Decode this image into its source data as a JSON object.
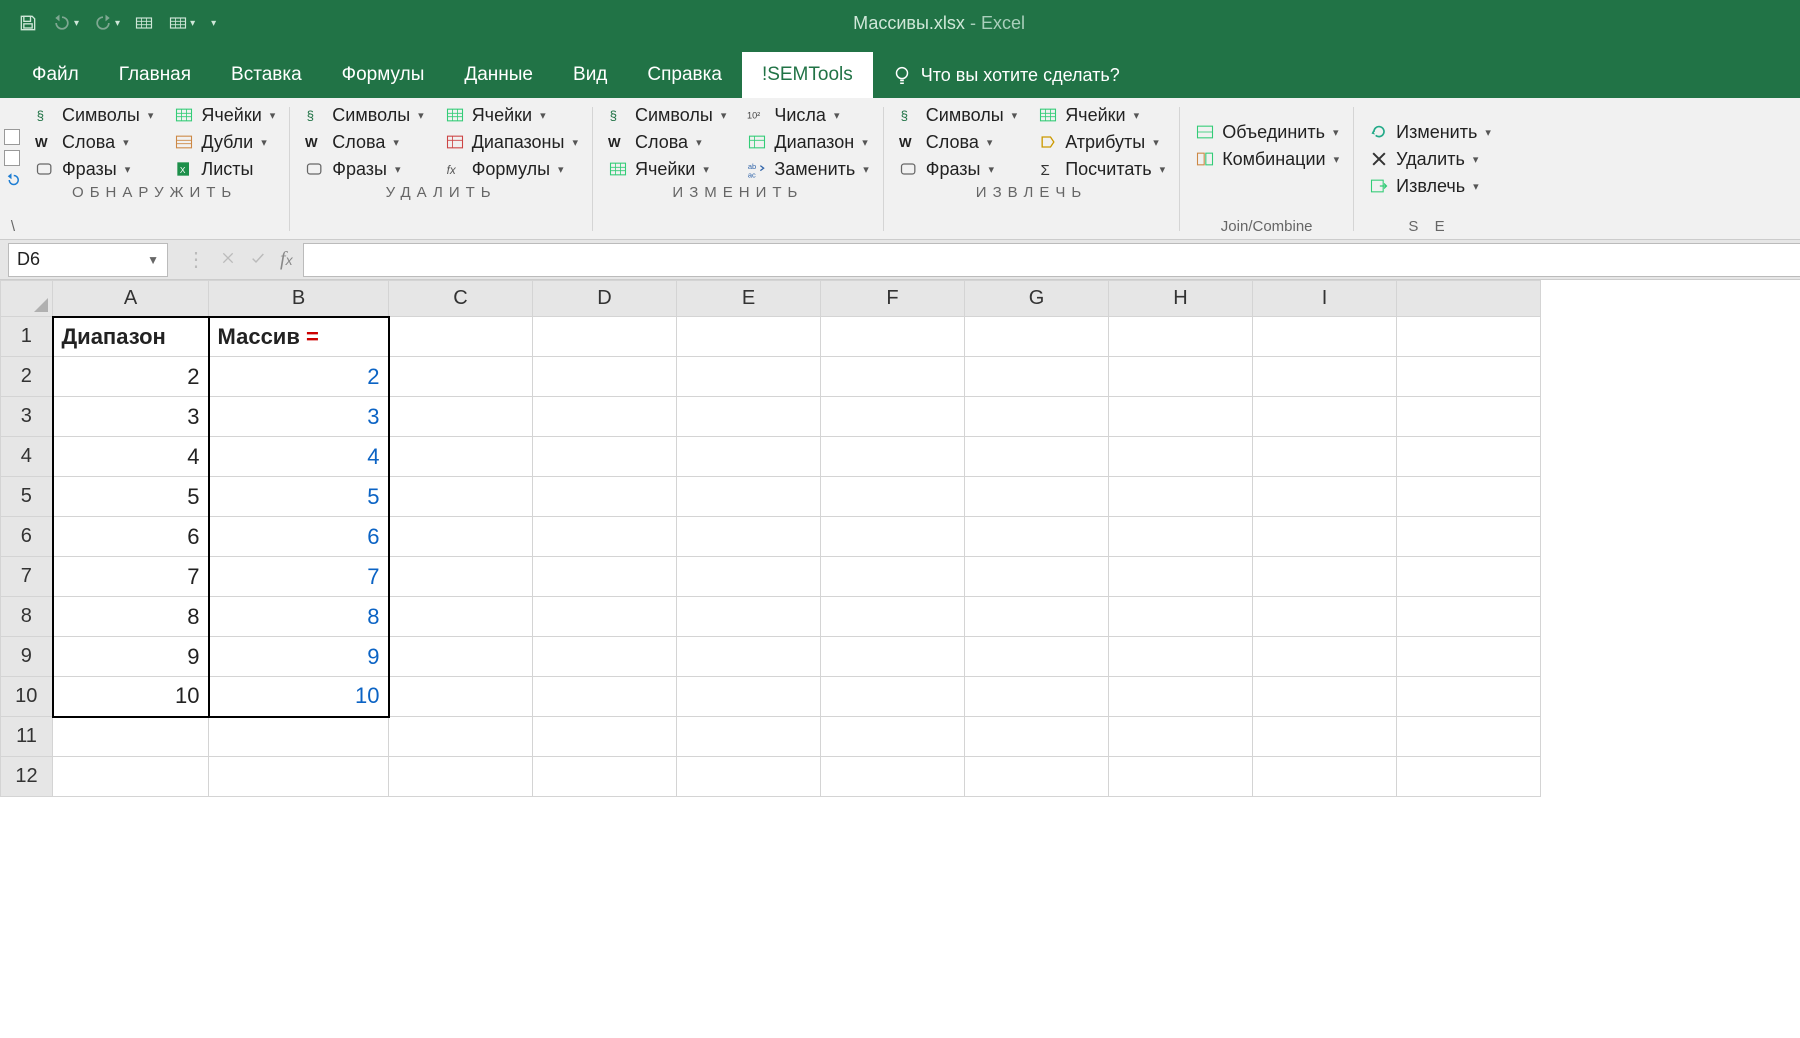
{
  "title": {
    "file": "Массивы.xlsx",
    "sep": " - ",
    "app": "Excel"
  },
  "tabs": [
    "Файл",
    "Главная",
    "Вставка",
    "Формулы",
    "Данные",
    "Вид",
    "Справка",
    "!SEMTools"
  ],
  "activeTab": 7,
  "tellme": "Что вы хотите сделать?",
  "ribbon": {
    "g1": {
      "label": "ОБНАРУЖИТЬ",
      "col1": [
        "Символы",
        "Слова",
        "Фразы"
      ],
      "col2": [
        "Ячейки",
        "Дубли",
        "Листы"
      ]
    },
    "g2": {
      "label": "УДАЛИТЬ",
      "col1": [
        "Символы",
        "Слова",
        "Фразы"
      ],
      "col2": [
        "Ячейки",
        "Диапазоны",
        "Формулы"
      ]
    },
    "g3": {
      "label": "ИЗМЕНИТЬ",
      "col1": [
        "Символы",
        "Слова",
        "Ячейки"
      ],
      "col2": [
        "Числа",
        "Диапазон",
        "Заменить"
      ]
    },
    "g4": {
      "label": "ИЗВЛЕЧЬ",
      "col1": [
        "Символы",
        "Слова",
        "Фразы"
      ],
      "col2": [
        "Ячейки",
        "Атрибуты",
        "Посчитать"
      ]
    },
    "g5": {
      "label": "Join/Combine",
      "col1": [
        "Объединить",
        "Комбинации"
      ]
    },
    "g6": {
      "label": "S E",
      "col1": [
        "Изменить",
        "Удалить",
        "Извлечь"
      ]
    }
  },
  "namebox": "D6",
  "columns": [
    "A",
    "B",
    "C",
    "D",
    "E",
    "F",
    "G",
    "H",
    "I"
  ],
  "rows": [
    "1",
    "2",
    "3",
    "4",
    "5",
    "6",
    "7",
    "8",
    "9",
    "10",
    "11",
    "12"
  ],
  "header": {
    "A": "Диапазон",
    "B": "Массив ",
    "Beq": "="
  },
  "dataA": [
    "2",
    "3",
    "4",
    "5",
    "6",
    "7",
    "8",
    "9",
    "10"
  ],
  "dataB": [
    "2",
    "3",
    "4",
    "5",
    "6",
    "7",
    "8",
    "9",
    "10"
  ]
}
